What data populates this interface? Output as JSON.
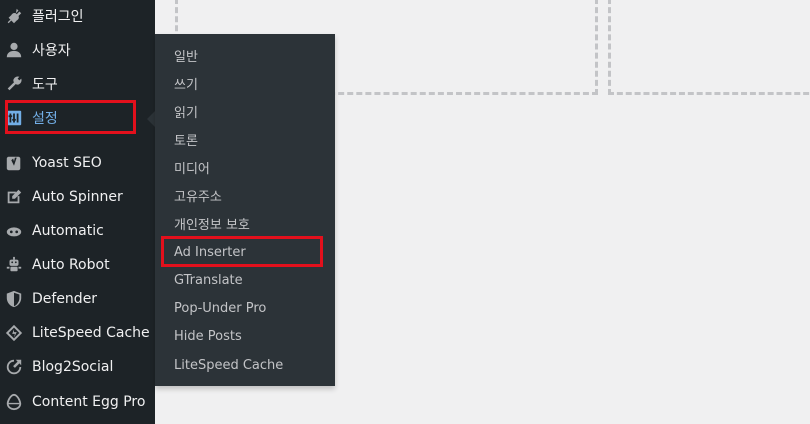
{
  "sidebar": {
    "items": [
      {
        "label": "플러그인",
        "icon": "plugin-icon"
      },
      {
        "label": "사용자",
        "icon": "users-icon"
      },
      {
        "label": "도구",
        "icon": "wrench-icon"
      },
      {
        "label": "설정",
        "icon": "settings-icon",
        "active": true
      },
      {
        "label": "Yoast SEO",
        "icon": "yoast-icon"
      },
      {
        "label": "Auto Spinner",
        "icon": "pencil-square-icon"
      },
      {
        "label": "Automatic",
        "icon": "cloud-icon"
      },
      {
        "label": "Auto Robot",
        "icon": "robot-icon"
      },
      {
        "label": "Defender",
        "icon": "shield-icon"
      },
      {
        "label": "LiteSpeed Cache",
        "icon": "litespeed-diamond-icon"
      },
      {
        "label": "Blog2Social",
        "icon": "share-arrow-icon"
      },
      {
        "label": "Content Egg Pro",
        "icon": "egg-icon"
      }
    ]
  },
  "submenu": {
    "items": [
      {
        "label": "일반"
      },
      {
        "label": "쓰기"
      },
      {
        "label": "읽기"
      },
      {
        "label": "토론"
      },
      {
        "label": "미디어"
      },
      {
        "label": "고유주소"
      },
      {
        "label": "개인정보 보호"
      },
      {
        "label": "Ad Inserter",
        "highlighted": true
      },
      {
        "label": "GTranslate"
      },
      {
        "label": "Pop-Under Pro"
      },
      {
        "label": "Hide Posts"
      },
      {
        "label": "LiteSpeed Cache"
      }
    ]
  },
  "colors": {
    "sidebar_bg": "#1d2327",
    "flyout_bg": "#2c3338",
    "active_text": "#72aee6",
    "highlight_border": "#e3101c"
  }
}
